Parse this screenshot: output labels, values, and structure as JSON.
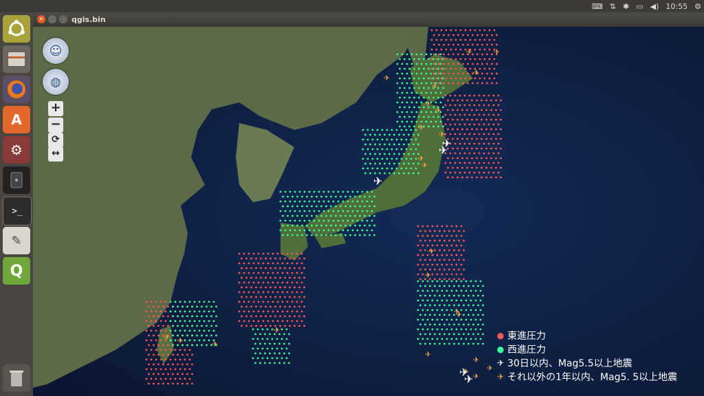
{
  "topbar": {
    "clock": "10:55",
    "icons": [
      "keyboard-icon",
      "network-arrows-icon",
      "bluetooth-icon",
      "battery-icon",
      "volume-icon",
      "gear-icon"
    ]
  },
  "window": {
    "title": "qgis.bin",
    "buttons": [
      "close",
      "minimize",
      "maximize"
    ]
  },
  "launcher": {
    "items": [
      "ubuntu-dash",
      "files",
      "firefox",
      "software-center",
      "system-settings",
      "usb-drive",
      "terminal",
      "text-editor",
      "qgis",
      "trash"
    ]
  },
  "map_tools": {
    "zoom_in": "+",
    "zoom_out": "−",
    "refresh": "⟳",
    "swap": "↔"
  },
  "legend": {
    "items": [
      {
        "label": "東進圧力",
        "symbol": "dot",
        "color": "#ff5a5a"
      },
      {
        "label": "西進圧力",
        "symbol": "dot",
        "color": "#3dff9a"
      },
      {
        "label": "30日以内、Mag5.5以上地震",
        "symbol": "plane",
        "color": "#ffffff"
      },
      {
        "label": "それ以外の1年以内、Mag5. 5以上地震",
        "symbol": "plane",
        "color": "#f5a742"
      }
    ]
  },
  "colors": {
    "east_pressure": "#ff5a5a",
    "west_pressure": "#3dff9a",
    "recent_quake": "#ffffff",
    "older_quake": "#f5a742",
    "ubuntu_orange": "#e95420"
  }
}
